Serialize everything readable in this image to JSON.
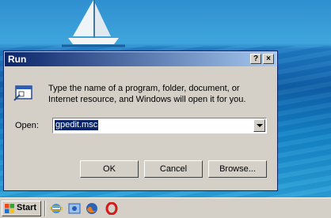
{
  "window": {
    "title": "Run",
    "help_label": "?",
    "close_label": "×"
  },
  "run": {
    "description": "Type the name of a program, folder, document, or Internet resource, and Windows will open it for you.",
    "open_label": "Open:",
    "open_value": "gpedit.msc"
  },
  "buttons": {
    "ok": "OK",
    "cancel": "Cancel",
    "browse": "Browse..."
  },
  "taskbar": {
    "start_label": "Start",
    "quick_launch": [
      "ie-icon",
      "update-icon",
      "firefox-icon",
      "opera-icon"
    ]
  }
}
